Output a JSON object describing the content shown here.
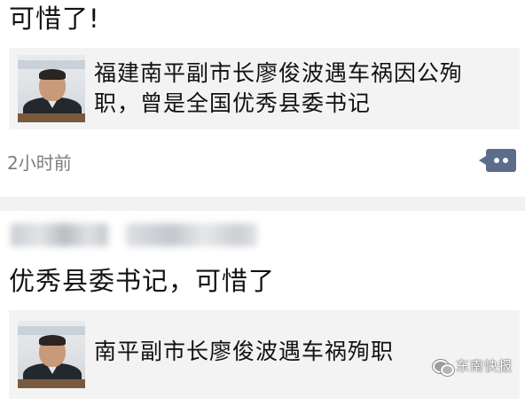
{
  "posts": [
    {
      "text": "可惜了!",
      "card": {
        "title": "福建南平副市长廖俊波遇车祸因公殉职，曾是全国优秀县委书记"
      },
      "timestamp": "2小时前"
    },
    {
      "text": "优秀县委书记，可惜了",
      "card": {
        "title": "南平副市长廖俊波遇车祸殉职"
      }
    }
  ],
  "watermark": {
    "text": "东南快报"
  },
  "icons": {
    "comment": "comment-bubble-icon",
    "watermark_logo": "wechat-logo-icon"
  },
  "colors": {
    "comment_button": "#5b6d8b",
    "timestamp": "#7d7d7d",
    "card_bg": "#f3f3f3",
    "divider": "#f2f2f2"
  }
}
